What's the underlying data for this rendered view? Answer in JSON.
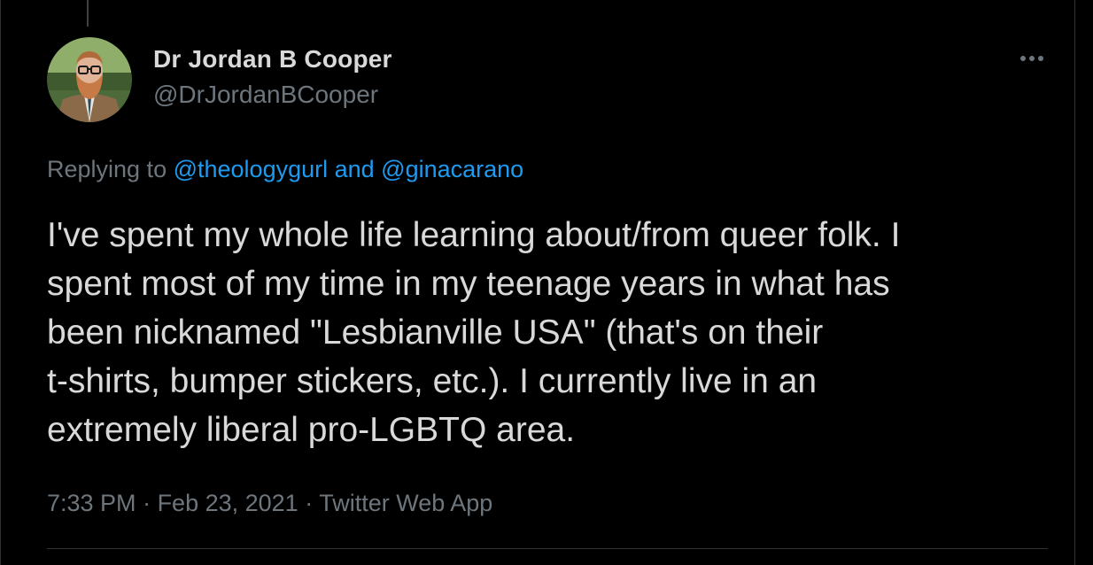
{
  "author": {
    "display_name": "Dr Jordan B Cooper",
    "handle": "@DrJordanBCooper",
    "avatar_icon": "profile-photo-bearded-man"
  },
  "more_icon": "ellipsis-icon",
  "reply_context": {
    "prefix": "Replying to ",
    "mention_1": "@theologygurl",
    "conjunction": " and ",
    "mention_2": "@ginacarano"
  },
  "tweet": {
    "text": "I've spent my whole life learning about/from queer folk. I\nspent most of my time in my teenage years in what has\nbeen nicknamed \"Lesbianville USA\" (that's on their\nt-shirts, bumper stickers, etc.). I currently live in an\nextremely liberal pro-LGBTQ area."
  },
  "meta": {
    "time": "7:33 PM",
    "sep_1": " · ",
    "date": "Feb 23, 2021",
    "sep_2": " · ",
    "source": "Twitter Web App"
  },
  "colors": {
    "background": "#000000",
    "text": "#d9d9d9",
    "secondary": "#6e767d",
    "link": "#1d9bf0"
  }
}
